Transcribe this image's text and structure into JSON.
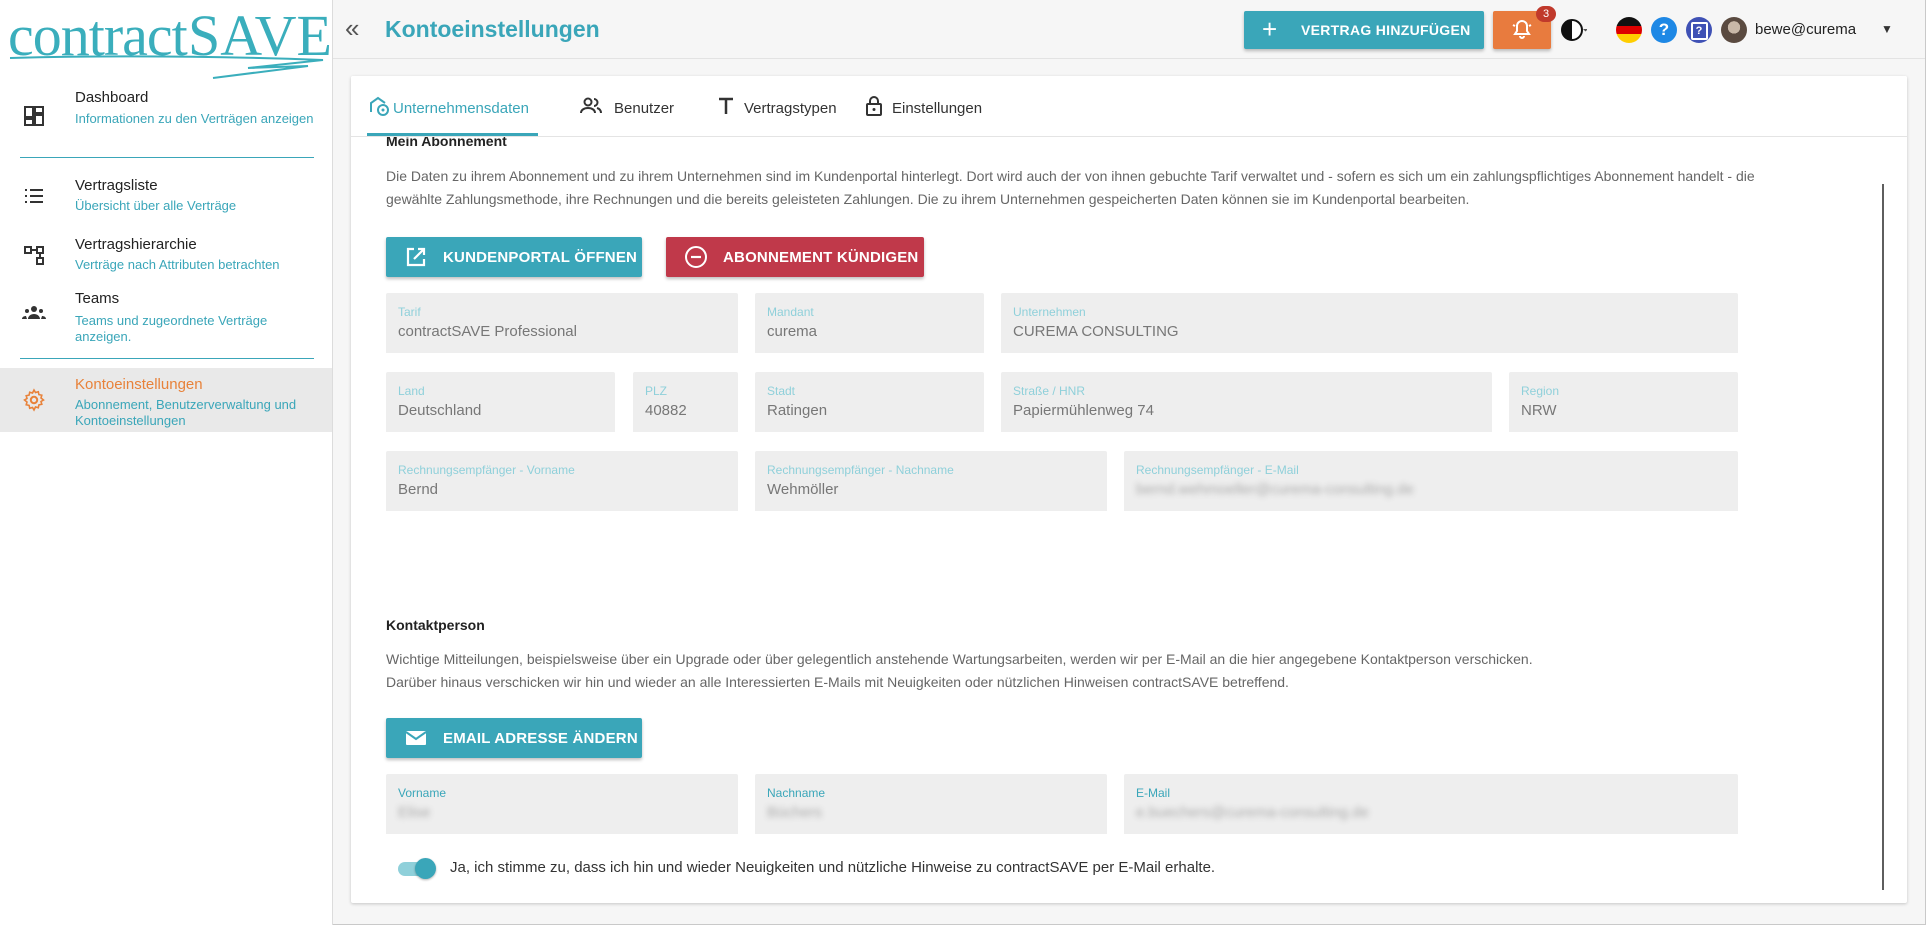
{
  "app": {
    "logo_part1": "contract",
    "logo_part2": "SAVE"
  },
  "sidebar": {
    "items": [
      {
        "title": "Dashboard",
        "subtitle": "Informationen zu den Verträgen anzeigen",
        "icon": "dashboard-icon"
      },
      {
        "title": "Vertragsliste",
        "subtitle": "Übersicht über alle Verträge",
        "icon": "list-icon"
      },
      {
        "title": "Vertragshierarchie",
        "subtitle": "Verträge nach Attributen betrachten",
        "icon": "hierarchy-icon"
      },
      {
        "title": "Teams",
        "subtitle": "Teams und zugeordnete Verträge anzeigen.",
        "icon": "teams-icon"
      },
      {
        "title": "Kontoeinstellungen",
        "subtitle": "Abonnement, Benutzerverwaltung und Kontoeinstellungen",
        "icon": "gear-icon",
        "active": true
      }
    ]
  },
  "header": {
    "page_title": "Kontoeinstellungen",
    "add_contract_label": "VERTRAG HINZUFÜGEN",
    "notification_count": "3",
    "help_label": "?",
    "help2_label": "?",
    "user_email": "bewe@curema"
  },
  "tabs": [
    {
      "label": "Unternehmensdaten",
      "icon": "company-settings-icon",
      "active": true
    },
    {
      "label": "Benutzer",
      "icon": "users-icon"
    },
    {
      "label": "Vertragstypen",
      "icon": "text-type-icon"
    },
    {
      "label": "Einstellungen",
      "icon": "lock-icon"
    }
  ],
  "subscription": {
    "heading": "Mein Abonnement",
    "description": "Die Daten zu ihrem Abonnement und zu ihrem Unternehmen sind im Kundenportal hinterlegt. Dort wird auch der von ihnen gebuchte Tarif verwaltet und - sofern es sich um ein zahlungspflichtiges Abonnement handelt - die gewählte Zahlungsmethode, ihre Rechnungen und die bereits geleisteten Zahlungen. Die zu ihrem Unternehmen gespeicherten Daten können sie im Kundenportal bearbeiten.",
    "portal_button": "KUNDENPORTAL ÖFFNEN",
    "cancel_button": "ABONNEMENT KÜNDIGEN",
    "fields": {
      "tarif": {
        "label": "Tarif",
        "value": "contractSAVE Professional"
      },
      "mandant": {
        "label": "Mandant",
        "value": "curema"
      },
      "unternehmen": {
        "label": "Unternehmen",
        "value": "CUREMA CONSULTING"
      },
      "land": {
        "label": "Land",
        "value": "Deutschland"
      },
      "plz": {
        "label": "PLZ",
        "value": "40882"
      },
      "stadt": {
        "label": "Stadt",
        "value": "Ratingen"
      },
      "strasse": {
        "label": "Straße / HNR",
        "value": "Papiermühlenweg 74"
      },
      "region": {
        "label": "Region",
        "value": "NRW"
      },
      "re_vorname": {
        "label": "Rechnungsempfänger - Vorname",
        "value": "Bernd"
      },
      "re_nachname": {
        "label": "Rechnungsempfänger - Nachname",
        "value": "Wehmöller"
      },
      "re_email": {
        "label": "Rechnungsempfänger - E-Mail",
        "value": "bernd.wehmoeller@curema-consulting.de"
      }
    }
  },
  "contact": {
    "heading": "Kontaktperson",
    "description_line1": "Wichtige Mitteilungen, beispielsweise über ein Upgrade oder über gelegentlich anstehende Wartungsarbeiten, werden wir per E-Mail an die hier angegebene Kontaktperson verschicken.",
    "description_line2": "Darüber hinaus verschicken wir hin und wieder an alle Interessierten E-Mails mit Neuigkeiten oder nützlichen Hinweisen contractSAVE betreffend.",
    "email_button": "EMAIL ADRESSE ÄNDERN",
    "fields": {
      "vorname": {
        "label": "Vorname",
        "value": "Elise"
      },
      "nachname": {
        "label": "Nachname",
        "value": "Büchers"
      },
      "email": {
        "label": "E-Mail",
        "value": "e.buechers@curema-consulting.de"
      }
    },
    "consent_label": "Ja, ich stimme zu, dass ich hin und wieder Neuigkeiten und nützliche Hinweise zu contractSAVE per E-Mail erhalte.",
    "consent_checked": true
  },
  "colors": {
    "accent": "#3aa6b9",
    "orange": "#e87b3e",
    "danger": "#c0394a"
  }
}
